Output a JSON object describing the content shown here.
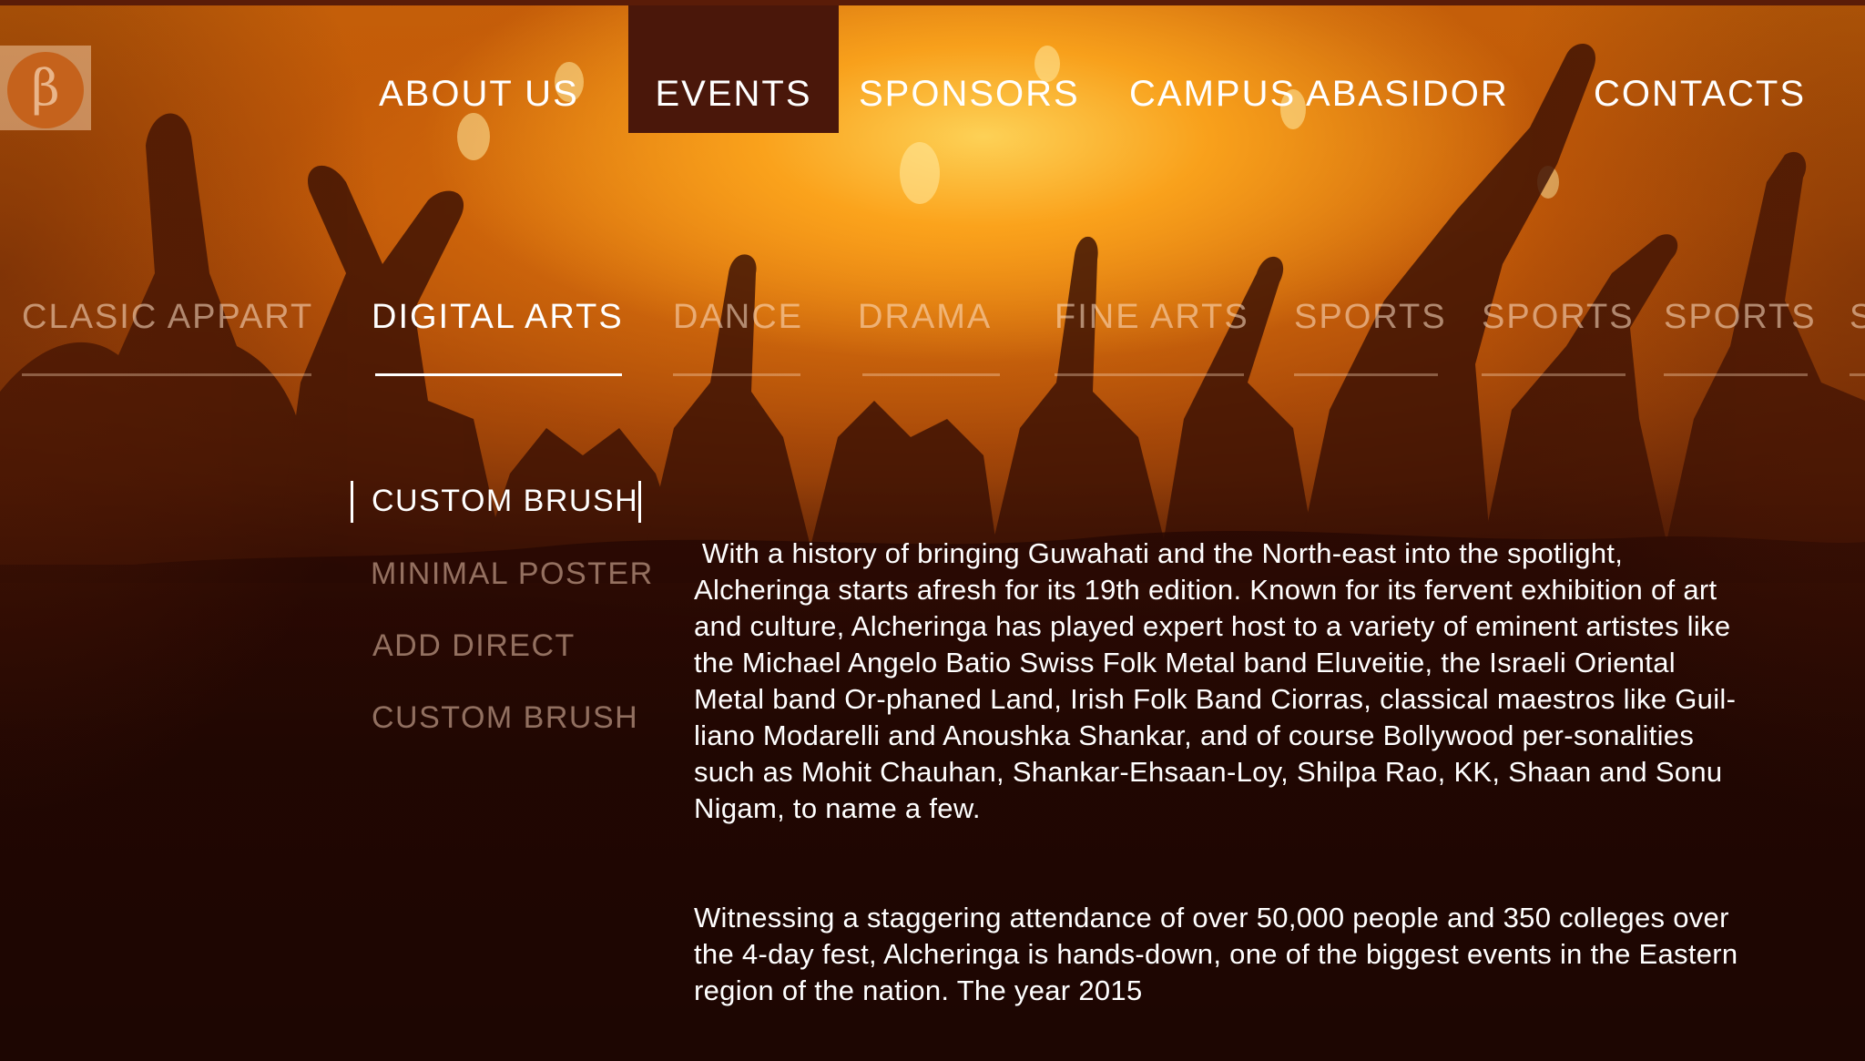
{
  "logo": {
    "glyph": "β",
    "icon": "beta-logo-icon"
  },
  "nav": {
    "items": [
      {
        "label": "ABOUT US",
        "active": false
      },
      {
        "label": "EVENTS",
        "active": true
      },
      {
        "label": "SPONSORS",
        "active": false
      },
      {
        "label": "CAMPUS ABASIDOR",
        "active": false
      },
      {
        "label": "CONTACTS",
        "active": false
      }
    ]
  },
  "categories": {
    "items": [
      {
        "label": "CLASIC APPART",
        "active": false
      },
      {
        "label": "DIGITAL ARTS",
        "active": true
      },
      {
        "label": "DANCE",
        "active": false
      },
      {
        "label": "DRAMA",
        "active": false
      },
      {
        "label": "FINE ARTS",
        "active": false
      },
      {
        "label": "SPORTS",
        "active": false
      },
      {
        "label": "SPORTS",
        "active": false
      },
      {
        "label": "SPORTS",
        "active": false
      },
      {
        "label": "S",
        "active": false
      }
    ]
  },
  "events": {
    "items": [
      {
        "label": "CUSTOM BRUSH",
        "active": true
      },
      {
        "label": "MINIMAL POSTER",
        "active": false
      },
      {
        "label": "ADD DIRECT",
        "active": false
      },
      {
        "label": "CUSTOM BRUSH",
        "active": false
      }
    ]
  },
  "description": {
    "para1": " With a history of bringing Guwahati and the North-east into the spotlight, Alcheringa starts afresh for its 19th edition. Known for its fervent exhibition of art and culture, Alcheringa has played expert host to a variety of eminent artistes like the Michael Angelo Batio Swiss Folk Metal band Eluveitie, the Israeli Oriental Metal band Or-phaned Land, Irish Folk Band Ciorras, classical maestros like Guil-liano Modarelli and Anoushka Shankar, and of course Bollywood per-sonalities such as Mohit Chauhan, Shankar-Ehsaan-Loy, Shilpa Rao, KK, Shaan and Sonu Nigam, to name a few.",
    "para2": "Witnessing a staggering attendance of over 50,000 people and 350 colleges over the 4-day fest, Alcheringa is hands-down, one of the biggest events in the Eastern region of the nation. The year 2015"
  },
  "colors": {
    "nav_active_bg": "#4a170a",
    "glow": "#f7b02a",
    "text": "#ffffff"
  }
}
